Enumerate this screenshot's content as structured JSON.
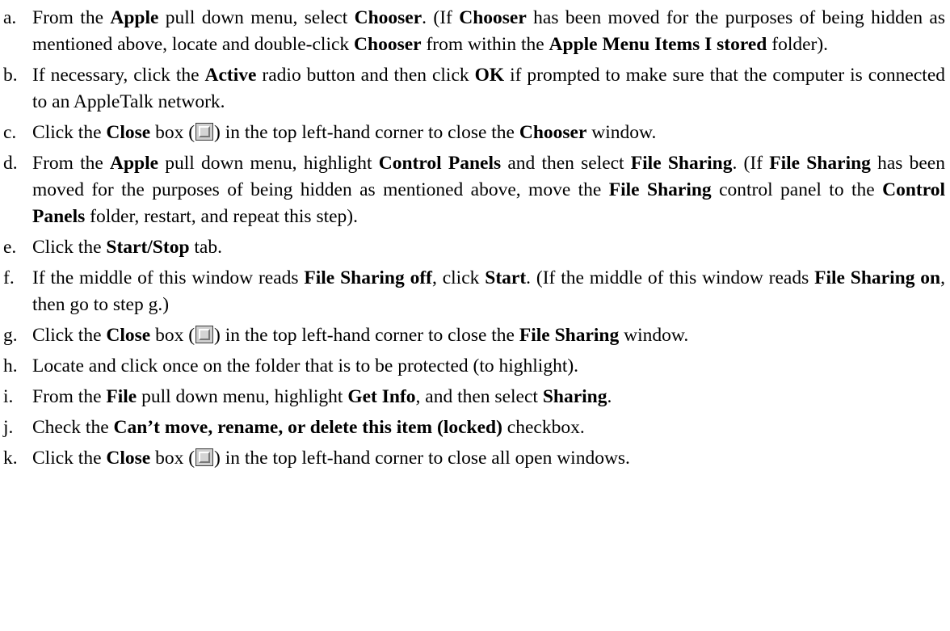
{
  "steps": [
    {
      "marker": "a.",
      "segments": [
        {
          "t": "From the "
        },
        {
          "t": "Apple",
          "b": true
        },
        {
          "t": " pull down menu, select "
        },
        {
          "t": "Chooser",
          "b": true
        },
        {
          "t": ". (If "
        },
        {
          "t": "Chooser",
          "b": true
        },
        {
          "t": " has been moved for the purposes of being hidden as mentioned above, locate and double-click "
        },
        {
          "t": "Chooser",
          "b": true
        },
        {
          "t": " from within the "
        },
        {
          "t": "Apple Menu Items I stored",
          "b": true
        },
        {
          "t": " folder)."
        }
      ]
    },
    {
      "marker": "b.",
      "segments": [
        {
          "t": "If necessary, click the "
        },
        {
          "t": "Active",
          "b": true
        },
        {
          "t": " radio button and then click "
        },
        {
          "t": "OK",
          "b": true
        },
        {
          "t": " if prompted to make sure that the computer is connected to an AppleTalk network."
        }
      ]
    },
    {
      "marker": "c.",
      "segments": [
        {
          "t": "Click the "
        },
        {
          "t": "Close",
          "b": true
        },
        {
          "t": " box ("
        },
        {
          "icon": "close-box"
        },
        {
          "t": ") in the top left-hand corner to close the "
        },
        {
          "t": "Chooser",
          "b": true
        },
        {
          "t": " window."
        }
      ]
    },
    {
      "marker": "d.",
      "segments": [
        {
          "t": "From the "
        },
        {
          "t": "Apple",
          "b": true
        },
        {
          "t": " pull down menu, highlight "
        },
        {
          "t": "Control Panels",
          "b": true
        },
        {
          "t": " and then select "
        },
        {
          "t": "File Sharing",
          "b": true
        },
        {
          "t": ". (If "
        },
        {
          "t": "File Sharing",
          "b": true
        },
        {
          "t": " has been moved for the purposes of being hidden as mentioned above, move the "
        },
        {
          "t": "File Sharing",
          "b": true
        },
        {
          "t": " control panel to the "
        },
        {
          "t": "Control Panels",
          "b": true
        },
        {
          "t": " folder, restart, and repeat this step)."
        }
      ]
    },
    {
      "marker": "e.",
      "segments": [
        {
          "t": "Click the "
        },
        {
          "t": "Start/Stop",
          "b": true
        },
        {
          "t": " tab."
        }
      ]
    },
    {
      "marker": "f.",
      "segments": [
        {
          "t": "If the middle of this window reads "
        },
        {
          "t": "File Sharing off",
          "b": true
        },
        {
          "t": ", click "
        },
        {
          "t": "Start",
          "b": true
        },
        {
          "t": ". (If the middle of this window reads "
        },
        {
          "t": "File Sharing on",
          "b": true
        },
        {
          "t": ", then go to step g.)"
        }
      ]
    },
    {
      "marker": "g.",
      "segments": [
        {
          "t": "Click the "
        },
        {
          "t": "Close",
          "b": true
        },
        {
          "t": " box ("
        },
        {
          "icon": "close-box"
        },
        {
          "t": ") in the top left-hand corner to close the "
        },
        {
          "t": "File Sharing",
          "b": true
        },
        {
          "t": " window."
        }
      ]
    },
    {
      "marker": "h.",
      "segments": [
        {
          "t": "Locate and click once on the folder that is to be protected (to highlight)."
        }
      ]
    },
    {
      "marker": "i.",
      "segments": [
        {
          "t": "From the "
        },
        {
          "t": "File",
          "b": true
        },
        {
          "t": " pull down menu, highlight "
        },
        {
          "t": "Get Info",
          "b": true
        },
        {
          "t": ", and then select "
        },
        {
          "t": "Sharing",
          "b": true
        },
        {
          "t": "."
        }
      ]
    },
    {
      "marker": "j.",
      "segments": [
        {
          "t": "Check the "
        },
        {
          "t": "Can’t move, rename, or delete this item (locked)",
          "b": true
        },
        {
          "t": " checkbox."
        }
      ]
    },
    {
      "marker": "k.",
      "segments": [
        {
          "t": "Click the "
        },
        {
          "t": "Close",
          "b": true
        },
        {
          "t": " box ("
        },
        {
          "icon": "close-box"
        },
        {
          "t": ") in the top left-hand corner to close all open windows."
        }
      ]
    }
  ]
}
